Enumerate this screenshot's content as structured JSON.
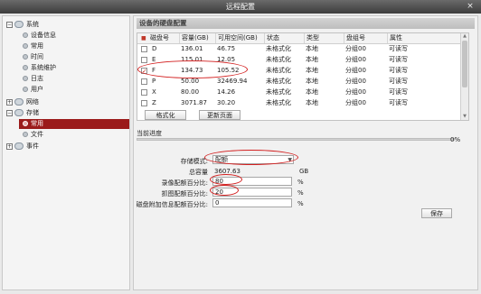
{
  "window": {
    "title": "远程配置",
    "close_glyph": "×"
  },
  "sidebar": {
    "items": [
      {
        "label": "系统",
        "level": 0,
        "expander": "−"
      },
      {
        "label": "设备信息",
        "level": 1
      },
      {
        "label": "常用",
        "level": 1
      },
      {
        "label": "时间",
        "level": 1
      },
      {
        "label": "系统维护",
        "level": 1
      },
      {
        "label": "日志",
        "level": 1
      },
      {
        "label": "用户",
        "level": 1
      },
      {
        "label": "网络",
        "level": 0,
        "expander": "+"
      },
      {
        "label": "存储",
        "level": 0,
        "expander": "−"
      },
      {
        "label": "常用",
        "level": 1,
        "selected": true
      },
      {
        "label": "文件",
        "level": 1
      },
      {
        "label": "事件",
        "level": 0,
        "expander": "+"
      }
    ]
  },
  "main": {
    "section_title": "设备的硬盘配置",
    "table": {
      "columns": [
        "磁盘号",
        "容量(GB)",
        "可用空间(GB)",
        "状态",
        "类型",
        "盘组号",
        "属性"
      ],
      "rows": [
        {
          "checked": false,
          "disk": "D",
          "capacity": "136.01",
          "free": "46.75",
          "status": "未格式化",
          "type": "本地",
          "group": "分组00",
          "attr": "可读写"
        },
        {
          "checked": false,
          "disk": "E",
          "capacity": "115.01",
          "free": "12.05",
          "status": "未格式化",
          "type": "本地",
          "group": "分组00",
          "attr": "可读写"
        },
        {
          "checked": true,
          "disk": "F",
          "capacity": "134.73",
          "free": "105.52",
          "status": "未格式化",
          "type": "本地",
          "group": "分组00",
          "attr": "可读写"
        },
        {
          "checked": false,
          "disk": "P",
          "capacity": "50.00",
          "free": "32469.94",
          "status": "未格式化",
          "type": "本地",
          "group": "分组00",
          "attr": "可读写"
        },
        {
          "checked": false,
          "disk": "X",
          "capacity": "80.00",
          "free": "14.26",
          "status": "未格式化",
          "type": "本地",
          "group": "分组00",
          "attr": "可读写"
        },
        {
          "checked": false,
          "disk": "Z",
          "capacity": "3071.87",
          "free": "30.20",
          "status": "未格式化",
          "type": "本地",
          "group": "分组00",
          "attr": "可读写"
        }
      ]
    },
    "buttons": {
      "format": "格式化",
      "refresh": "更新页面",
      "save": "保存"
    },
    "progress": {
      "label": "当前进度",
      "percent_text": "0%",
      "fraction": 0
    },
    "form": {
      "storage_mode_label": "存储模式:",
      "storage_mode_value": "配额",
      "total_capacity_label": "总容量",
      "total_capacity_value": "3607.63",
      "total_capacity_unit": "GB",
      "record_quota_label": "录像配额百分比:",
      "record_quota_value": "80",
      "picture_quota_label": "抓图配额百分比:",
      "picture_quota_value": "20",
      "extra_quota_label": "磁盘附加信息配额百分比:",
      "extra_quota_value": "0",
      "percent_unit": "%"
    }
  },
  "colors": {
    "accent_selected": "#9b1b1b",
    "annotation": "#d32020"
  }
}
